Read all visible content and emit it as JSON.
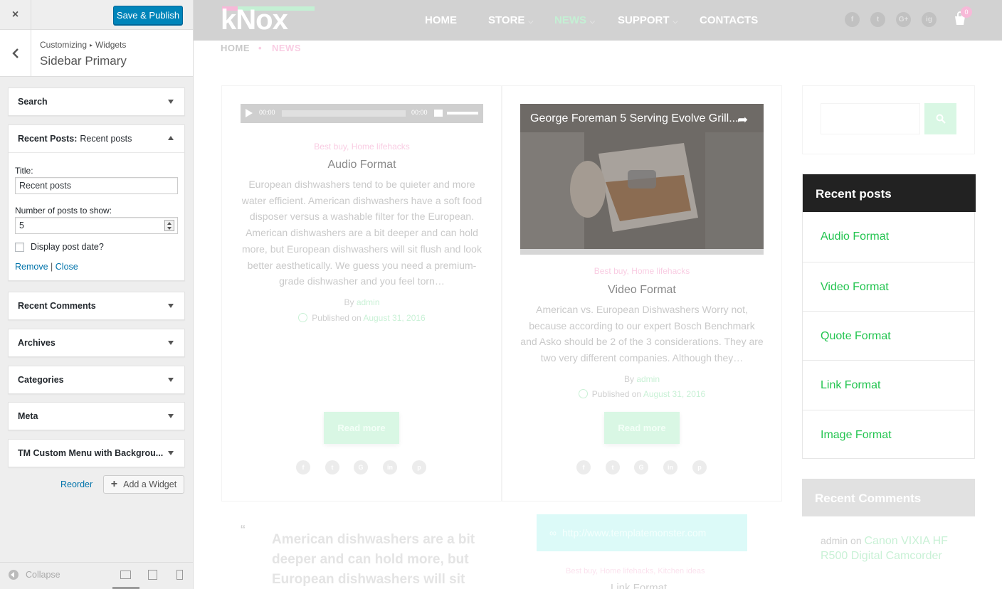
{
  "customizer": {
    "close_icon": "×",
    "save_label": "Save & Publish",
    "breadcrumb": {
      "root": "Customizing",
      "current": "Widgets"
    },
    "section_title": "Sidebar Primary",
    "widgets": [
      {
        "title": "Search"
      },
      {
        "title": "Recent Posts:",
        "subtitle": "Recent posts"
      },
      {
        "title": "Recent Comments"
      },
      {
        "title": "Archives"
      },
      {
        "title": "Categories"
      },
      {
        "title": "Meta"
      },
      {
        "title": "TM Custom Menu with Backgrou..."
      }
    ],
    "form": {
      "title_label": "Title:",
      "title_value": "Recent posts",
      "number_label": "Number of posts to show:",
      "number_value": "5",
      "checkbox_label": "Display post date?",
      "remove": "Remove",
      "sep": "|",
      "close": "Close"
    },
    "reorder": "Reorder",
    "add_widget": "Add a Widget",
    "collapse": "Collapse"
  },
  "site": {
    "logo": "kNox",
    "menu": [
      "HOME",
      "STORE",
      "NEWS",
      "SUPPORT",
      "CONTACTS"
    ],
    "social": [
      "f",
      "t",
      "G+",
      "ig"
    ],
    "cart_count": "0",
    "breadcrumb": {
      "home": "HOME",
      "dot": "•",
      "current": "NEWS"
    },
    "posts": [
      {
        "audio_time_start": "00:00",
        "audio_time_end": "00:00",
        "categories": "Best buy, Home lifehacks",
        "title": "Audio Format",
        "excerpt": "European dishwashers tend to be quieter and more water efficient. American dishwashers have a soft food disposer versus a washable filter for the European. American dishwashers are a bit deeper and can hold more, but European dishwashers will sit flush and look better aesthetically. We guess you need a premium-grade dishwasher and you feel torn…",
        "by": "By",
        "author": "admin",
        "published": "Published on",
        "date": "August 31, 2016",
        "read_more": "Read more"
      },
      {
        "video_title": "George Foreman 5 Serving Evolve Grill...",
        "categories": "Best buy, Home lifehacks",
        "title": "Video Format",
        "excerpt": "American vs. European Dishwashers Worry not, because according to our expert Bosch Benchmark and Asko should be 2 of the 3 considerations. They are two very different companies. Although they…",
        "by": "By",
        "author": "admin",
        "published": "Published on",
        "date": "August 31, 2016",
        "read_more": "Read more"
      }
    ],
    "quote_mark": "“",
    "quote": "American dishwashers are a bit deeper and can hold more, but European dishwashers will sit",
    "link_url": "http://www.templatemonster.com",
    "link_icon": "link-icon",
    "bottom_cat": "Best buy, Home lifehacks, Kitchen ideas",
    "bottom_title": "Link Format",
    "sidebar": {
      "recent_posts_title": "Recent posts",
      "recent_posts": [
        "Audio Format",
        "Video Format",
        "Quote Format",
        "Link Format",
        "Image Format"
      ],
      "recent_comments_title": "Recent Comments",
      "comment_author": "admin",
      "comment_on": "on",
      "comment_post": "Canon VIXIA HF R500 Digital Camcorder"
    }
  },
  "colors": {
    "accent_green": "#22c44f",
    "wp_blue": "#0085ba",
    "pink": "#f46bb1"
  }
}
